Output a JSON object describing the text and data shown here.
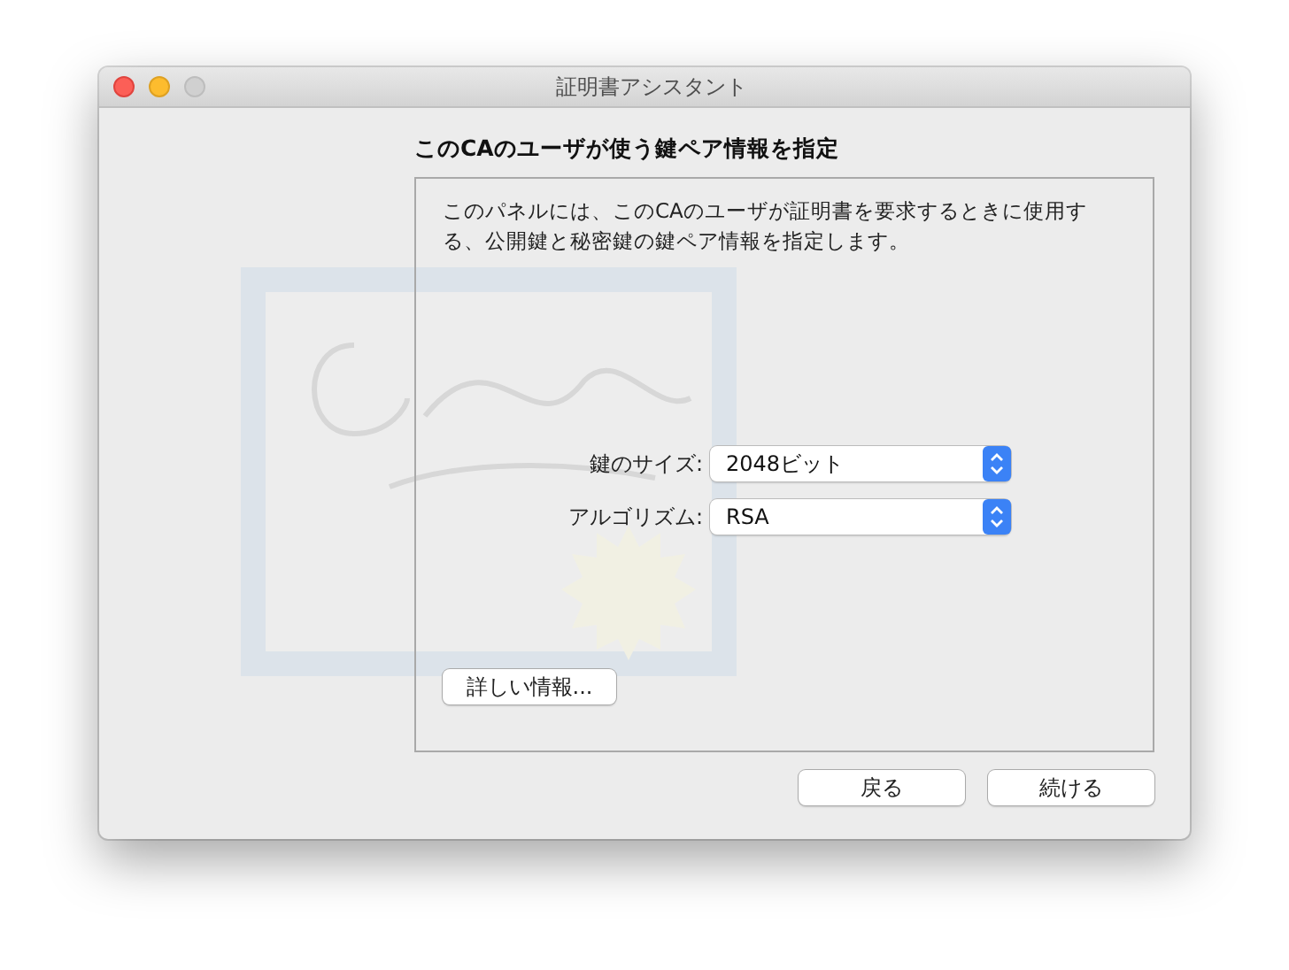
{
  "window": {
    "title": "証明書アシスタント"
  },
  "heading": "このCAのユーザが使う鍵ペア情報を指定",
  "description": "このパネルには、このCAのユーザが証明書を要求するときに使用する、公開鍵と秘密鍵の鍵ペア情報を指定します。",
  "fields": [
    {
      "label": "鍵のサイズ:",
      "value": "2048ビット"
    },
    {
      "label": "アルゴリズム:",
      "value": "RSA"
    }
  ],
  "more_info_button": "詳しい情報...",
  "buttons": [
    {
      "label": "戻る"
    },
    {
      "label": "続ける"
    }
  ]
}
